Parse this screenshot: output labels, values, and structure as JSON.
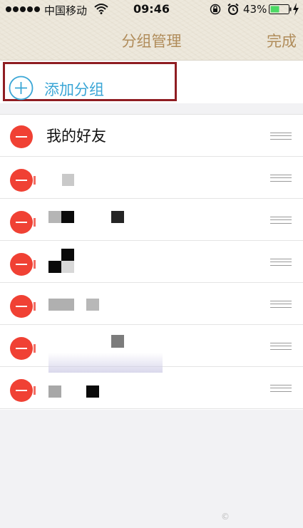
{
  "status_bar": {
    "carrier": "中国移动",
    "time": "09:46",
    "battery_percent": "43%",
    "icons": [
      "signal-dots-icon",
      "wifi-icon",
      "rotation-lock-icon",
      "alarm-icon",
      "battery-icon",
      "charging-bolt-icon"
    ]
  },
  "nav": {
    "title": "分组管理",
    "done_label": "完成"
  },
  "add_group": {
    "label": "添加分组",
    "icon": "plus-circle-icon"
  },
  "groups": [
    {
      "label": "我的好友",
      "redacted": false
    },
    {
      "label": "",
      "redacted": true
    },
    {
      "label": "",
      "redacted": true
    },
    {
      "label": "",
      "redacted": true
    },
    {
      "label": "",
      "redacted": true
    },
    {
      "label": "",
      "redacted": true
    },
    {
      "label": "",
      "redacted": true
    }
  ],
  "colors": {
    "accent": "#b08c5a",
    "link": "#3aa6d6",
    "delete": "#f04134",
    "highlight_border": "#8f1d22"
  }
}
